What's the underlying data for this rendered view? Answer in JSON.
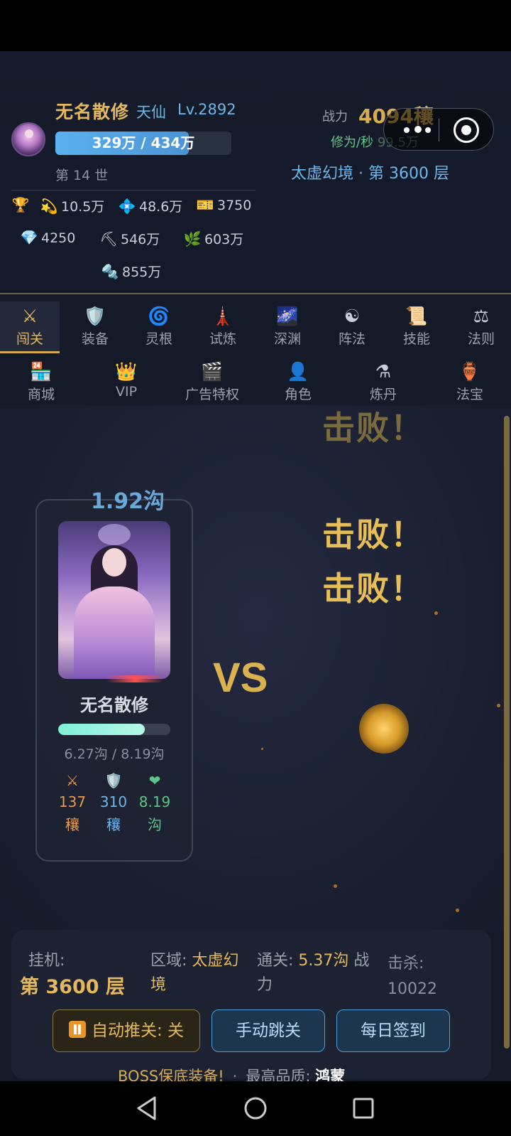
{
  "player": {
    "name": "无名散修",
    "realm": "天仙",
    "level": "Lv.2892",
    "exp_text": "329万 / 434万",
    "exp_progress": 0.76,
    "generation": "第 14 世"
  },
  "power": {
    "label": "战力",
    "value": "4094穰",
    "cultivation_label": "修为/秒",
    "cultivation_value": "99.5万",
    "floor_info": "太虚幻境 · 第 3600 层"
  },
  "resources": [
    {
      "icon": "trophy-icon",
      "glyph": "🏆",
      "value": ""
    },
    {
      "icon": "comet-icon",
      "glyph": "💫",
      "value": "10.5万"
    },
    {
      "icon": "crystal-icon",
      "glyph": "💠",
      "value": "48.6万"
    },
    {
      "icon": "ticket-icon",
      "glyph": "🎫",
      "value": "3750"
    },
    {
      "icon": "diamond-icon",
      "glyph": "💎",
      "value": "4250"
    },
    {
      "icon": "pickaxe-icon",
      "glyph": "⛏",
      "value": "546万"
    },
    {
      "icon": "herb-icon",
      "glyph": "🌿",
      "value": "603万"
    },
    {
      "icon": "ore-icon",
      "glyph": "🔩",
      "value": "855万"
    }
  ],
  "nav_row1": [
    {
      "label": "闯关",
      "glyph": "⚔",
      "icon": "swords-icon"
    },
    {
      "label": "装备",
      "glyph": "🛡️",
      "icon": "shield-icon"
    },
    {
      "label": "灵根",
      "glyph": "🌀",
      "icon": "spiral-icon"
    },
    {
      "label": "试炼",
      "glyph": "🗼",
      "icon": "tower-icon"
    },
    {
      "label": "深渊",
      "glyph": "🌌",
      "icon": "galaxy-icon"
    },
    {
      "label": "阵法",
      "glyph": "☯",
      "icon": "yinyang-icon"
    },
    {
      "label": "技能",
      "glyph": "📜",
      "icon": "scroll-icon"
    },
    {
      "label": "法则",
      "glyph": "⚖",
      "icon": "scales-icon"
    }
  ],
  "nav_row2": [
    {
      "label": "商城",
      "glyph": "🏪",
      "icon": "store-icon"
    },
    {
      "label": "VIP",
      "glyph": "👑",
      "icon": "crown-icon"
    },
    {
      "label": "广告特权",
      "glyph": "🎬",
      "icon": "clapper-icon"
    },
    {
      "label": "角色",
      "glyph": "👤",
      "icon": "person-icon"
    },
    {
      "label": "炼丹",
      "glyph": "⚗",
      "icon": "alembic-icon"
    },
    {
      "label": "法宝",
      "glyph": "🏺",
      "icon": "amphora-icon"
    }
  ],
  "battle": {
    "defeat_text": "击败！",
    "damage": "1.92沟",
    "vs": "VS",
    "hero": {
      "name": "无名散修",
      "hp_text": "6.27沟 / 8.19沟",
      "hp_ratio": 0.77,
      "atk_value": "137",
      "atk_unit": "穰",
      "def_value": "310",
      "def_unit": "穰",
      "hp_value": "8.19",
      "hp_unit": "沟",
      "atk_glyph": "⚔",
      "def_glyph": "🛡️",
      "hp_glyph": "❤"
    }
  },
  "panel": {
    "idle_label": "挂机:",
    "idle_floor": "第 3600 层",
    "region_label": "区域:",
    "region_value_1": "太虚幻",
    "region_value_2": "境",
    "clear_label": "通关:",
    "clear_value": "5.37沟",
    "clear_suffix_1": "战",
    "clear_suffix_2": "力",
    "kills_label": "击杀:",
    "kills_value": "10022",
    "auto_button": "自动推关: 关",
    "jump_button": "手动跳关",
    "daily_button": "每日签到",
    "boss_text": "BOSS保底装备!",
    "boss_sep": "·",
    "quality_label": "最高品质:",
    "quality_value": "鸿蒙"
  },
  "colors": {
    "gold": "#e4b85c",
    "blue": "#6db6ec",
    "green": "#5ec48a",
    "bg": "#151a29"
  }
}
